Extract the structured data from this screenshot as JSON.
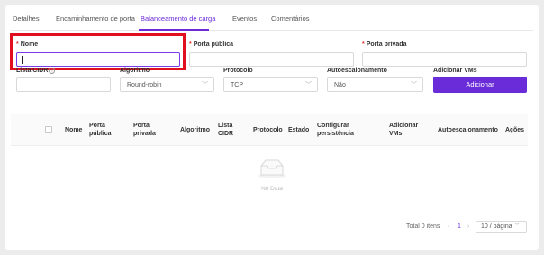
{
  "tabs": [
    "Detalhes",
    "Encaminhamento de porta",
    "Balanceamento de carga",
    "Eventos",
    "Comentários"
  ],
  "form": {
    "nome_label": "Nome",
    "porta_publica_label": "Porta pública",
    "porta_privada_label": "Porta privada",
    "lista_cidr_label": "Lista CIDR",
    "algoritmo_label": "Algoritmo",
    "algoritmo_value": "Round-robin",
    "protocolo_label": "Protocolo",
    "protocolo_value": "TCP",
    "autoescalonamento_label": "Autoescalonamento",
    "autoescalonamento_value": "Não",
    "adicionar_vms_label": "Adicionar VMs",
    "adicionar_button": "Adicionar",
    "required_mark": "*"
  },
  "table": {
    "headers": [
      "Nome",
      "Porta pública",
      "Porta privada",
      "Algoritmo",
      "Lista CIDR",
      "Protocolo",
      "Estado",
      "Configurar persistência",
      "Adicionar VMs",
      "Autoescalonamento",
      "Ações"
    ],
    "empty_text": "No Data"
  },
  "pagination": {
    "total": "Total 0 itens",
    "current_page": "1",
    "page_size": "10 / página"
  },
  "colors": {
    "accent": "#6a2bd8",
    "required": "#e53935",
    "highlight": "#e0101f"
  },
  "icons": {
    "info": "info-icon",
    "chevron": "chevron-down-icon",
    "empty": "empty-box-icon"
  }
}
